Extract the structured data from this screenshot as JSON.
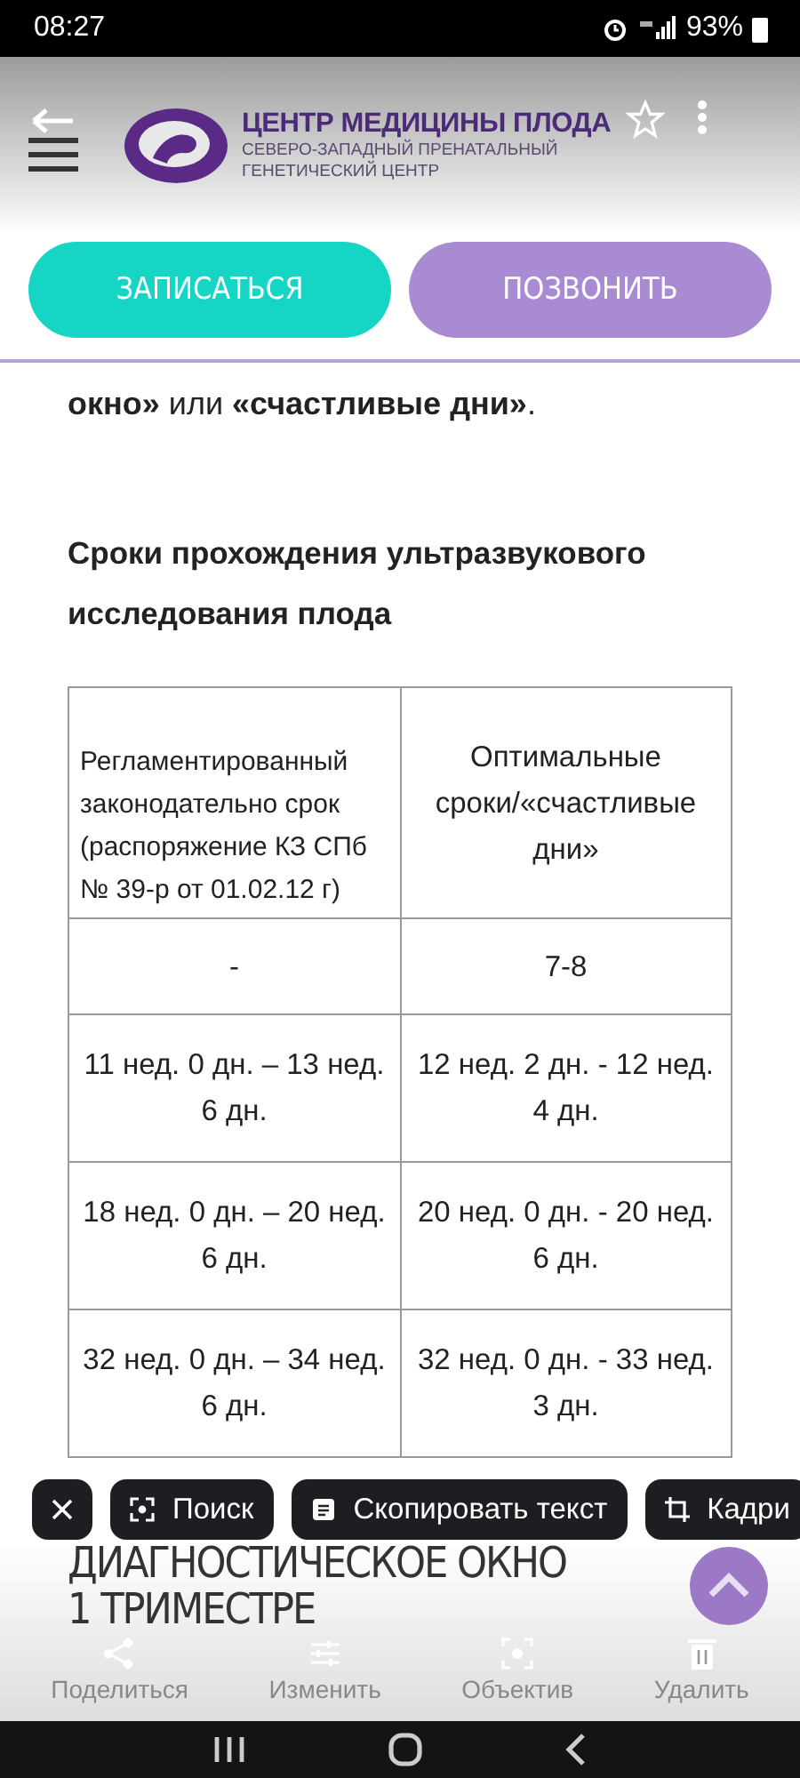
{
  "status_bar": {
    "time": "08:27",
    "battery": "93%"
  },
  "header": {
    "title": "ЦЕНТР МЕДИЦИНЫ ПЛОДА",
    "subtitle_lines": [
      "СЕВЕРО-ЗАПАДНЫЙ ПРЕНАТАЛЬНЫЙ",
      "ГЕНЕТИЧЕСКИЙ ЦЕНТР"
    ]
  },
  "buttons": [
    {
      "label": "ЗАПИСАТЬСЯ",
      "kind": "primary"
    },
    {
      "label": "ПОЗВОНИТЬ",
      "kind": "secondary"
    }
  ],
  "paragraph": "**окно»** или **«счастливые дни»**.",
  "section_title": "Сроки прохождения ультразвукового исследования плода",
  "table": {
    "columns": [
      "Регламентированный законодательно срок (распоряжение КЗ СПб № 39-р от 01.02.12 г)",
      "Оптимальные сроки/«счастливые дни»"
    ],
    "rows": [
      [
        "-",
        "7-8"
      ],
      [
        "11 нед. 0 дн. – 13 нед. 6 дн.",
        "12 нед. 2 дн. - 12 нед. 4 дн."
      ],
      [
        "18 нед. 0 дн. – 20 нед. 6 дн.",
        "20 нед. 0 дн. - 20 нед. 6 дн."
      ],
      [
        "32 нед. 0 дн. – 34 нед. 6 дн.",
        "32 нед. 0 дн. - 33 нед. 3 дн."
      ]
    ]
  },
  "chips": [
    {
      "kind": "close"
    },
    {
      "label": "Поиск",
      "kind": "search"
    },
    {
      "label": "Скопировать текст",
      "kind": "copy"
    },
    {
      "label": "Кадри",
      "kind": "crop"
    }
  ],
  "heading_lines": [
    "ДИАГНОСТИЧЕСКОЕ ОКНО",
    "1 ТРИМЕСТРЕ"
  ],
  "actions": [
    {
      "label": "Поделиться",
      "kind": "share"
    },
    {
      "label": "Изменить",
      "kind": "edit"
    },
    {
      "label": "Объектив",
      "kind": "lens"
    },
    {
      "label": "Удалить",
      "kind": "delete"
    }
  ]
}
